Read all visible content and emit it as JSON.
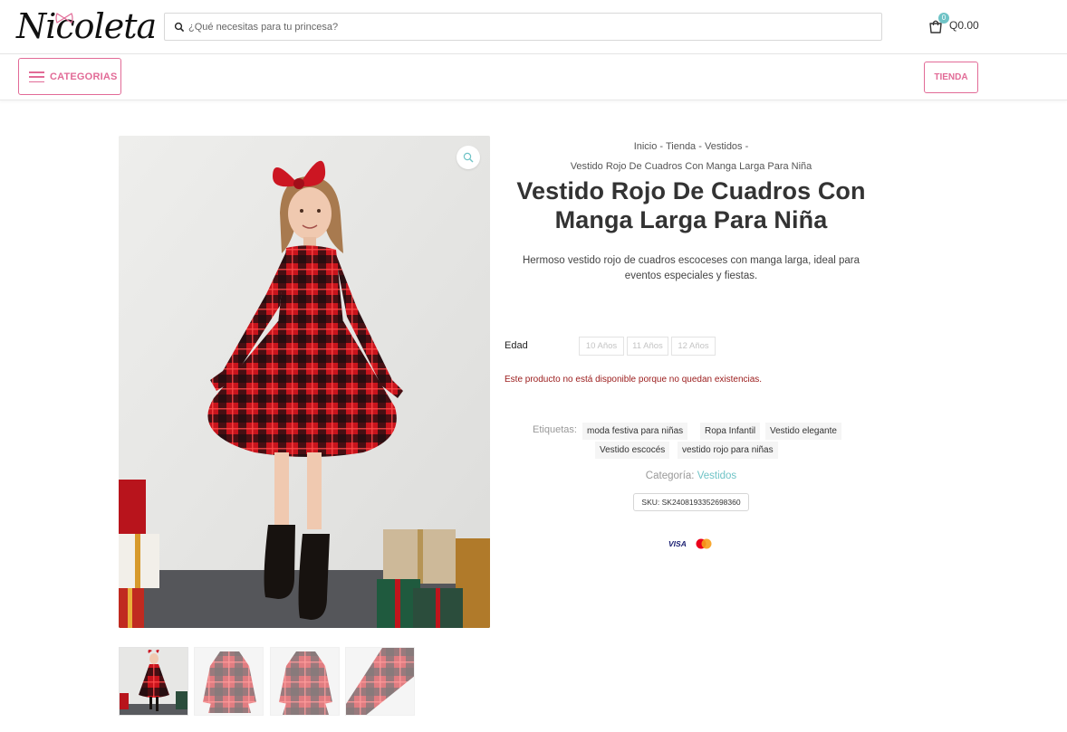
{
  "header": {
    "logo_text": "Nicoleta",
    "search_placeholder": "¿Qué necesitas para tu princesa?",
    "cart_count": "0",
    "cart_total": "Q0.00"
  },
  "nav": {
    "categories_label": "CATEGORIAS",
    "shop_label": "TIENDA"
  },
  "breadcrumb": {
    "items": [
      "Inicio",
      "Tienda",
      "Vestidos"
    ],
    "separator": " - ",
    "current": "Vestido Rojo De Cuadros Con Manga Larga Para Niña"
  },
  "product": {
    "title": "Vestido Rojo De Cuadros Con Manga Larga Para Niña",
    "description": "Hermoso vestido rojo de cuadros escoceses con manga larga, ideal para eventos especiales y fiestas.",
    "attribute_label": "Edad",
    "age_options": [
      "10 Años",
      "11 Años",
      "12 Años"
    ],
    "stock_message": "Este producto no está disponible porque no quedan existencias.",
    "tags_label": "Etiquetas:",
    "tags": [
      "moda festiva para niñas",
      "Ropa Infantil",
      "Vestido elegante",
      "Vestido escocés",
      "vestido rojo para niñas"
    ],
    "category_label": "Categoría:",
    "category": "Vestidos",
    "sku": "SKU: SK2408193352698360",
    "payment_methods": [
      "VISA",
      "mastercard"
    ]
  },
  "gallery": {
    "thumbnail_count": 4
  },
  "colors": {
    "accent_pink": "#e26b97",
    "teal": "#6fc3c6",
    "stock_red": "#9a1a1a"
  }
}
